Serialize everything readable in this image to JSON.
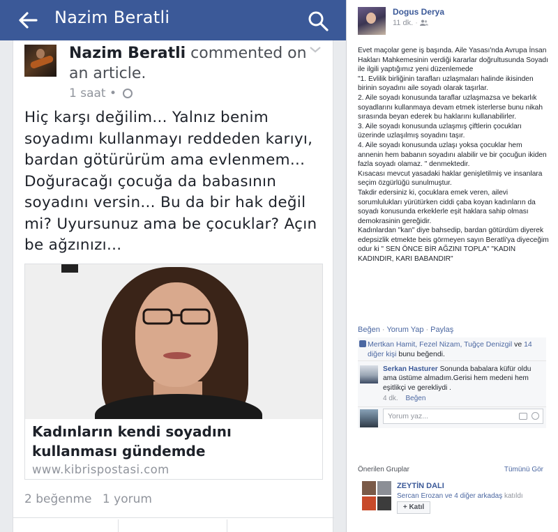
{
  "phone": {
    "appbar": {
      "title": "Nazim Beratli"
    },
    "post": {
      "author": "Nazim Beratli",
      "action": "commented on an article.",
      "time": "1 saat",
      "text": "Hiç karşı değilim... Yalnız benim soyadımı kullanmayı reddeden karıyı, bardan götürürüm ama evlenmem... Doğuracağı çocuğa da babasının soyadını versin... Bu da bir hak değil mi? Uyursunuz ama be çocuklar? Açın be ağzınızı...",
      "link": {
        "title": "Kadınların kendi soyadını kullanması gündemde",
        "domain": "www.kibrispostasi.com"
      },
      "likes": "2 beğenme",
      "comments": "1 yorum"
    }
  },
  "fb": {
    "author": "Dogus Derya",
    "time": "11 dk.",
    "body": [
      "Evet maçolar gene iş başında. Aile Yasası'nda Avrupa İnsan Hakları Mahkemesinin verdiği kararlar doğrultusunda Soyadı ile ilgili yaptığımız yeni düzenlemede",
      "\"1. Evlilik birliğinin tarafları uzlaşmaları halinde ikisinden birinin soyadını aile soyadı olarak taşırlar.",
      "2. Aile soyadı konusunda taraflar uzlaşmazsa ve bekarlık soyadlarını kullanmaya devam etmek isterlerse bunu nikah sırasında beyan ederek bu haklarını kullanabilirler.",
      "3. Aile soyadı konusunda uzlaşmış çiftlerin çocukları üzerinde uzlaşılmış soyadını taşır.",
      "4. Aile soyadı konusunda uzlaşı yoksa çocuklar hem annenin hem babanın soyadını alabilir ve bir çocuğun ikiden fazla soyadı olamaz. \" denmektedir.",
      "Kısacası mevcut yasadaki haklar genişletilmiş ve insanlara seçim özgürlüğü sunulmuştur.",
      "Takdir edersiniz ki, çocuklara emek veren, ailevi sorumlulukları yürütürken ciddi çaba koyan kadınların da soyadı konusunda erkeklerle eşit haklara sahip olması demokrasinin gereğidir.",
      "Kadınlardan \"kan\" diye bahsedip, bardan götürdüm diyerek edepsizlik etmekte beis görmeyen sayın Beratli'ya diyeceğim odur ki \" SEN ÖNCE BİR AĞZINI TOPLA\" \"KADIN KADINDIR, KARI BABANDIR\""
    ],
    "actions": {
      "like": "Beğen",
      "comment": "Yorum Yap",
      "share": "Paylaş"
    },
    "likes": {
      "names": "Mertkan Hamit, Fezel Nizam, Tuğçe Denizgil",
      "and": "ve",
      "others": "14 diğer kişi",
      "suffix": "bunu beğendi."
    },
    "comment": {
      "author": "Serkan Hasturer",
      "text": "Sonunda babalara küfür oldu ama üstüme almadım.Gerisi hem medeni hem eşitlikçi ve gerekliydi .",
      "time": "4 dk.",
      "like": "Beğen"
    },
    "write_placeholder": "Yorum yaz...",
    "groups": {
      "heading": "Önerilen Gruplar",
      "see_all": "Tümünü Gör",
      "name": "ZEYTİN DALI",
      "members_link": "Sercan Erozan ve 4 diğer arkadaş",
      "members_suffix": "katıldı",
      "join_label": "+ Katıl"
    }
  }
}
